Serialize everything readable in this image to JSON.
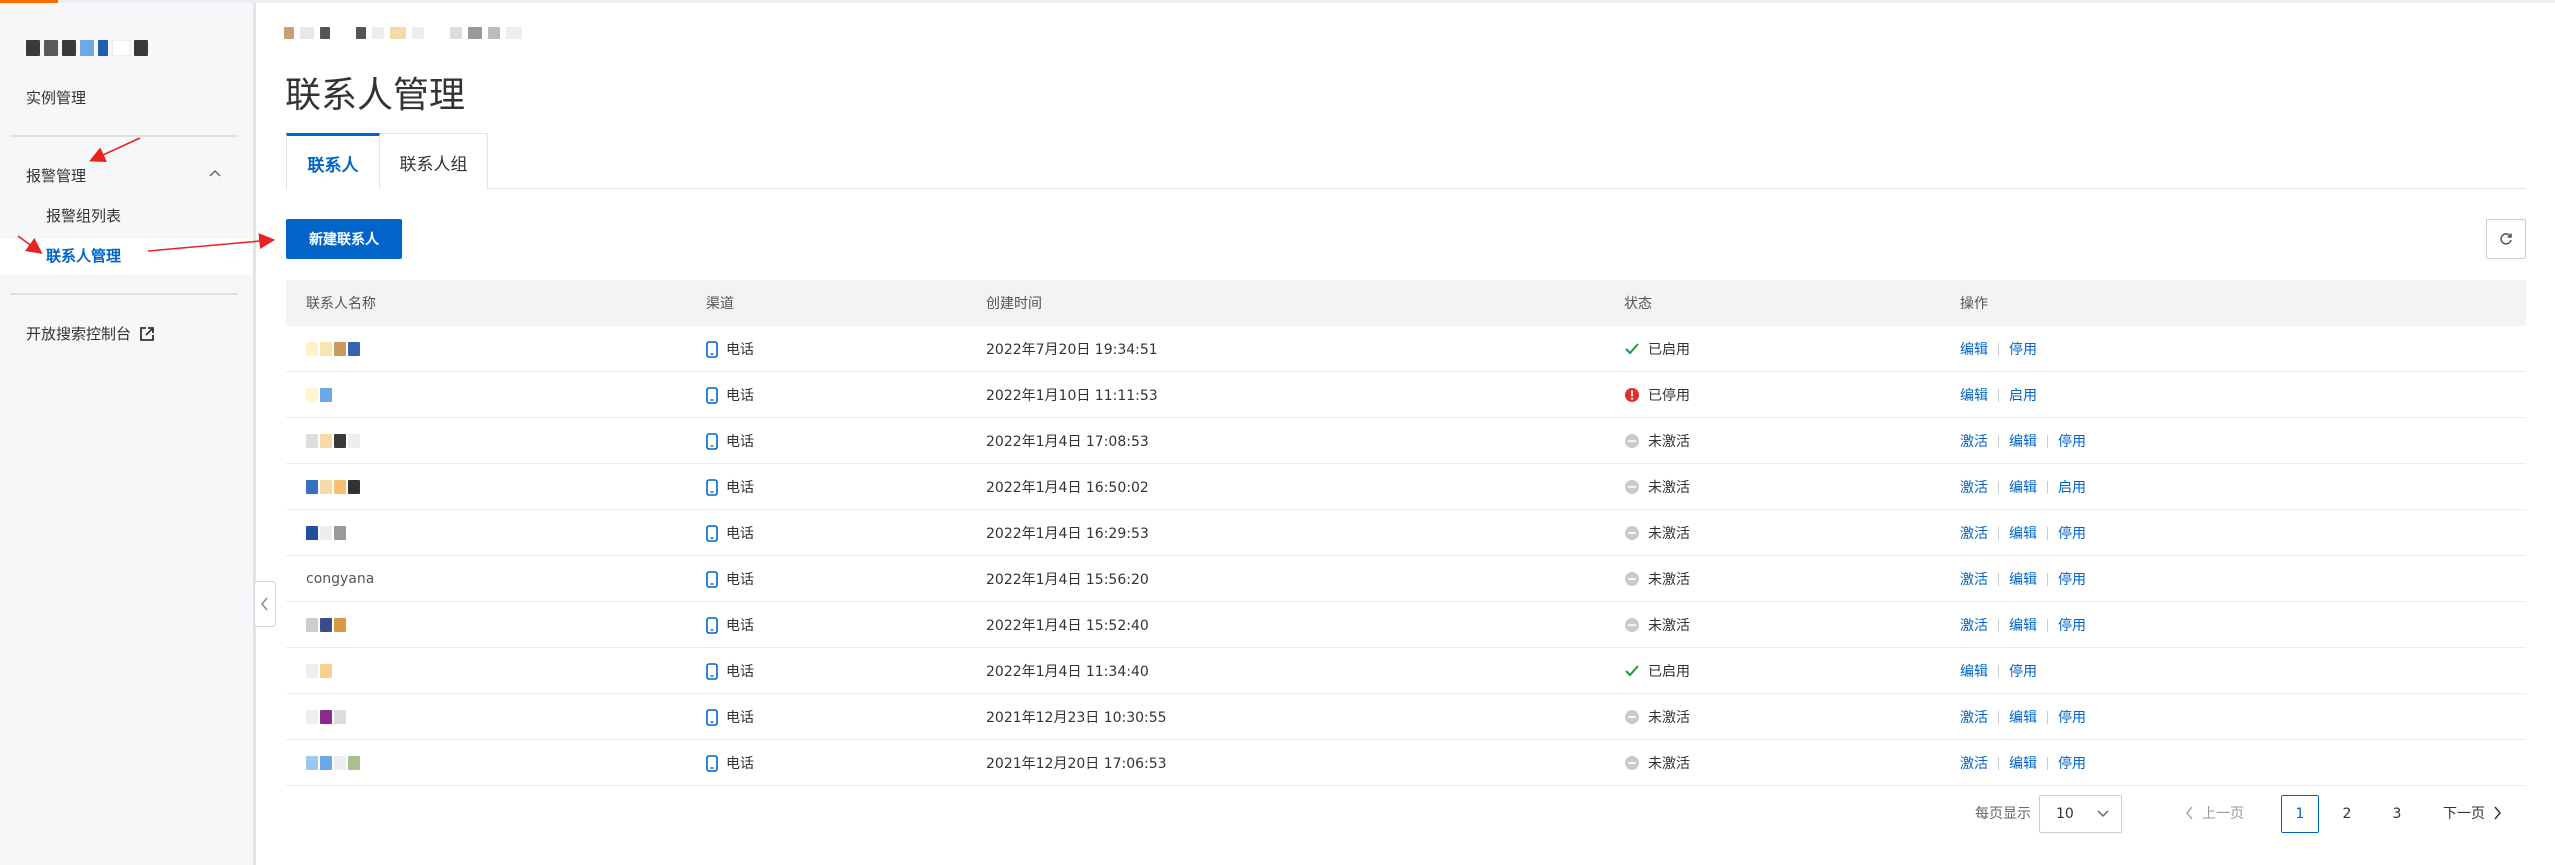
{
  "colors": {
    "accent": "#0064c8",
    "brand_top": "#ff6a00",
    "status_enabled": "#1a9c3c",
    "status_disabled": "#e3302f",
    "status_inactive": "#bfc3c8",
    "annotation_arrow": "#e8231f"
  },
  "sidebar": {
    "items": [
      {
        "label": "实例管理"
      },
      {
        "label": "报警管理",
        "expanded": true
      },
      {
        "label": "报警组列表"
      },
      {
        "label": "联系人管理",
        "active": true
      },
      {
        "label": "开放搜索控制台",
        "icon": "external-link-icon"
      }
    ]
  },
  "main": {
    "title": "联系人管理",
    "tabs": [
      {
        "label": "联系人",
        "active": true
      },
      {
        "label": "联系人组"
      }
    ],
    "new_button_label": "新建联系人",
    "refresh_icon": "refresh-icon"
  },
  "table": {
    "columns": [
      "联系人名称",
      "渠道",
      "创建时间",
      "状态",
      "操作"
    ],
    "rows": [
      {
        "name": "",
        "channel": "电话",
        "created": "2022年7月20日 19:34:51",
        "status": "已启用",
        "status_type": "enabled",
        "actions": [
          "编辑",
          "停用"
        ]
      },
      {
        "name": "",
        "channel": "电话",
        "created": "2022年1月10日 11:11:53",
        "status": "已停用",
        "status_type": "disabled",
        "actions": [
          "编辑",
          "启用"
        ]
      },
      {
        "name": "",
        "channel": "电话",
        "created": "2022年1月4日 17:08:53",
        "status": "未激活",
        "status_type": "inactive",
        "actions": [
          "激活",
          "编辑",
          "停用"
        ]
      },
      {
        "name": "",
        "channel": "电话",
        "created": "2022年1月4日 16:50:02",
        "status": "未激活",
        "status_type": "inactive",
        "actions": [
          "激活",
          "编辑",
          "启用"
        ]
      },
      {
        "name": "",
        "channel": "电话",
        "created": "2022年1月4日 16:29:53",
        "status": "未激活",
        "status_type": "inactive",
        "actions": [
          "激活",
          "编辑",
          "停用"
        ]
      },
      {
        "name": "congyana",
        "channel": "电话",
        "created": "2022年1月4日 15:56:20",
        "status": "未激活",
        "status_type": "inactive",
        "actions": [
          "激活",
          "编辑",
          "停用"
        ]
      },
      {
        "name": "",
        "channel": "电话",
        "created": "2022年1月4日 15:52:40",
        "status": "未激活",
        "status_type": "inactive",
        "actions": [
          "激活",
          "编辑",
          "停用"
        ]
      },
      {
        "name": "",
        "channel": "电话",
        "created": "2022年1月4日 11:34:40",
        "status": "已启用",
        "status_type": "enabled",
        "actions": [
          "编辑",
          "停用"
        ]
      },
      {
        "name": "",
        "channel": "电话",
        "created": "2021年12月23日 10:30:55",
        "status": "未激活",
        "status_type": "inactive",
        "actions": [
          "激活",
          "编辑",
          "停用"
        ]
      },
      {
        "name": "",
        "channel": "电话",
        "created": "2021年12月20日 17:06:53",
        "status": "未激活",
        "status_type": "inactive",
        "actions": [
          "激活",
          "编辑",
          "停用"
        ]
      }
    ]
  },
  "pagination": {
    "page_size_label": "每页显示",
    "page_size": "10",
    "prev_label": "上一页",
    "next_label": "下一页",
    "pages": [
      "1",
      "2",
      "3"
    ],
    "current_page": "1"
  }
}
